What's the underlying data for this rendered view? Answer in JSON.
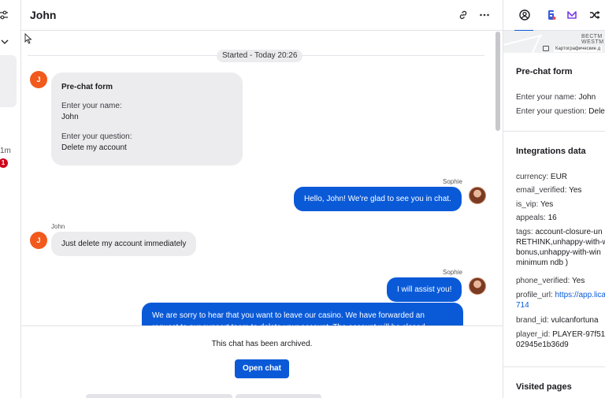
{
  "left_strip": {
    "time_label": "1m",
    "unread_count": "1"
  },
  "chat": {
    "title": "John",
    "started_label": "Started - Today 20:26",
    "prechat": {
      "title": "Pre-chat form",
      "name_label": "Enter your name:",
      "name_value": "John",
      "question_label": "Enter your question:",
      "question_value": "Delete my account",
      "avatar_initial": "J"
    },
    "messages": [
      {
        "sender": "Sophie",
        "text": "Hello, John! We're glad to see you in chat.",
        "direction": "out"
      },
      {
        "sender": "John",
        "text": "Just delete my account immediately",
        "direction": "in",
        "avatar_initial": "J"
      },
      {
        "sender": "Sophie",
        "text": "I will assist you!",
        "direction": "out"
      },
      {
        "sender": "Sophie",
        "text": "We are sorry to hear that you want to leave our casino. We have forwarded an request to our support team to delete your account. The account will be closed",
        "direction": "out"
      }
    ]
  },
  "footer": {
    "archived_text": "This chat has been archived.",
    "open_chat_label": "Open chat"
  },
  "right_panel": {
    "map": {
      "street_line1": "ВЕСТМ",
      "street_line2": "WESTM",
      "attribution": "Картографические д"
    },
    "prechat": {
      "title": "Pre-chat form",
      "name_key": "Enter your name:",
      "name_value": "John",
      "question_key": "Enter your question:",
      "question_value": "Dele"
    },
    "integrations": {
      "title": "Integrations data",
      "currency_key": "currency:",
      "currency_value": "EUR",
      "email_key": "email_verified:",
      "email_value": "Yes",
      "vip_key": "is_vip:",
      "vip_value": "Yes",
      "appeals_key": "appeals:",
      "appeals_value": "16",
      "tags_key": "tags:",
      "tags_line1": "account-closure-un",
      "tags_line2": "RETHINK,unhappy-with-w",
      "tags_line3": "bonus,unhappy-with-win",
      "tags_line4": "minimum ndb )",
      "phone_key": "phone_verified:",
      "phone_value": "Yes",
      "profile_key": "profile_url:",
      "profile_line1": "https://app.lica",
      "profile_line2": "714",
      "brand_key": "brand_id:",
      "brand_value": "vulcanfortuna",
      "player_key": "player_id:",
      "player_line1": "PLAYER-97f512",
      "player_line2": "02945e1b36d9"
    },
    "visited_title": "Visited pages"
  },
  "colors": {
    "accent": "#0a5ad8",
    "customer_avatar": "#f2591c",
    "bubble_gray": "#ececef",
    "badge_red": "#d0021b"
  }
}
